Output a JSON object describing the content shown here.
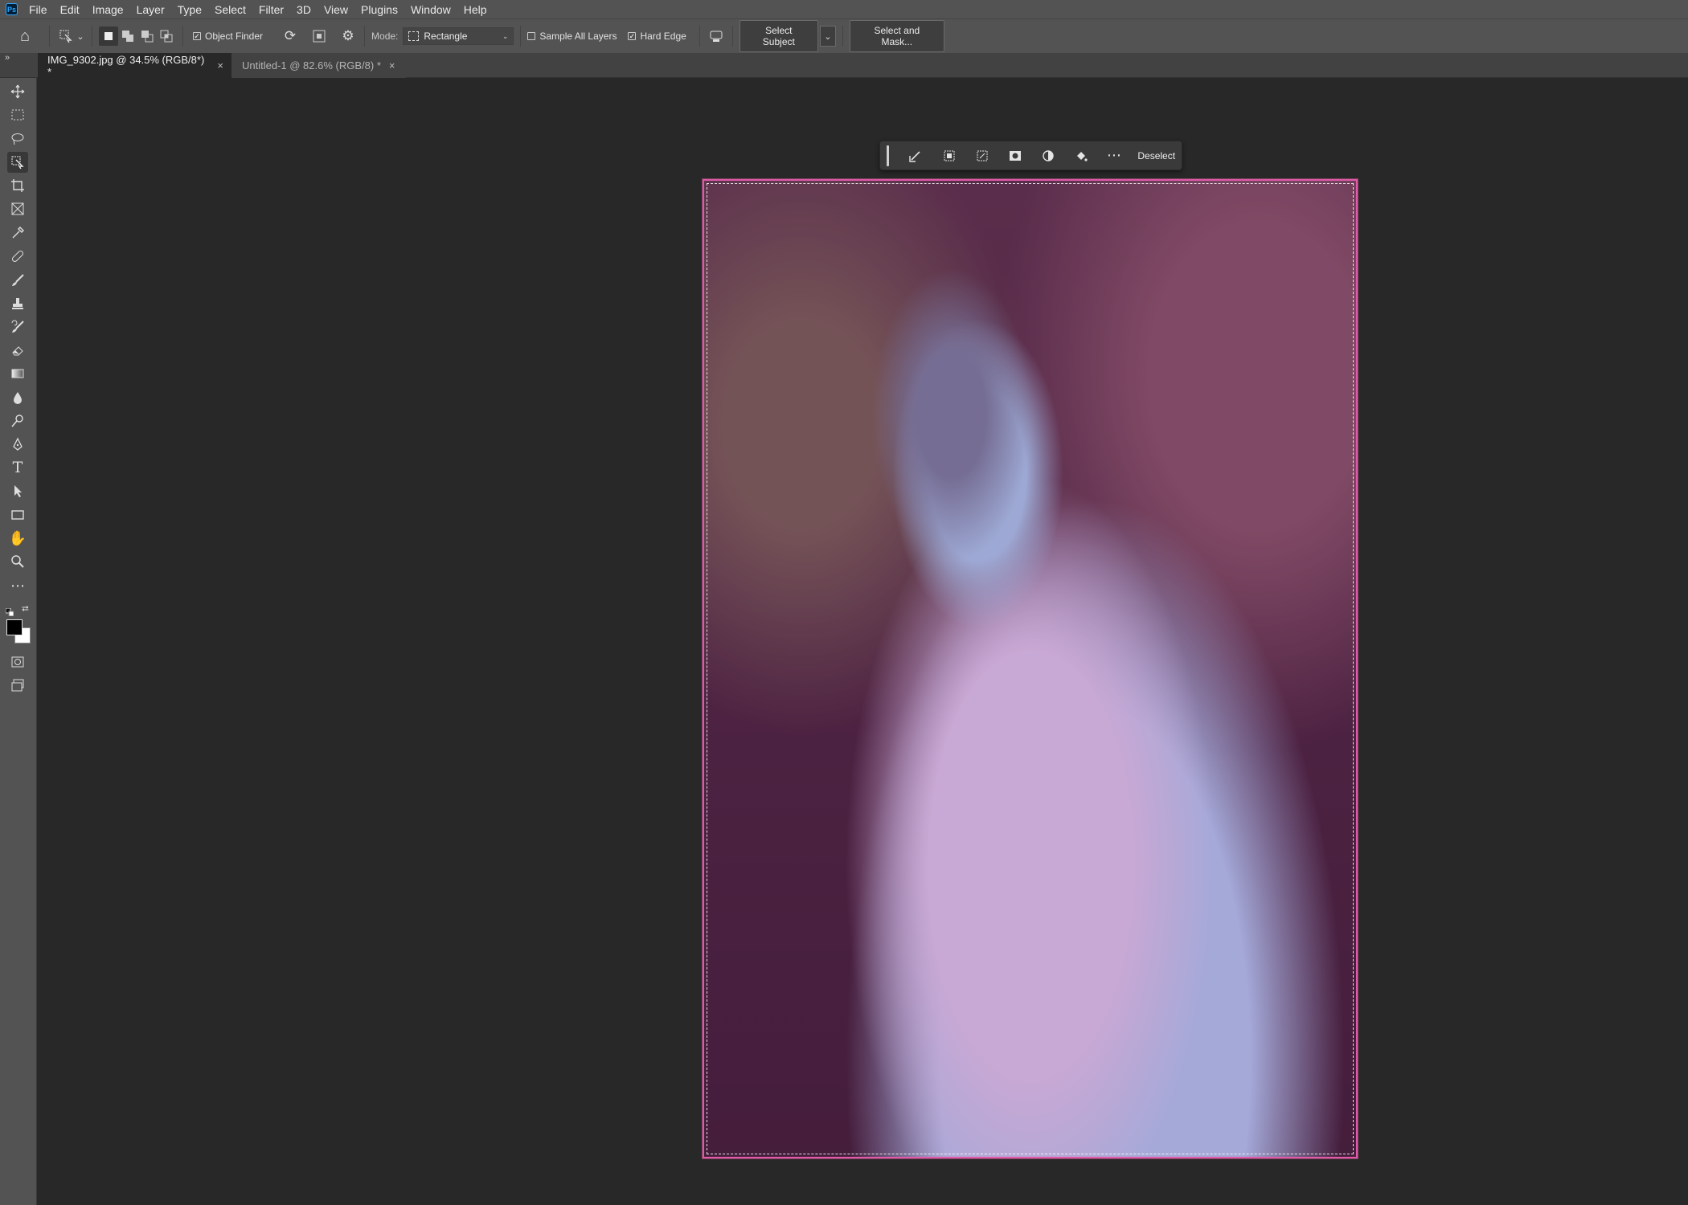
{
  "app": {
    "logo": "Ps"
  },
  "menu": [
    "File",
    "Edit",
    "Image",
    "Layer",
    "Type",
    "Select",
    "Filter",
    "3D",
    "View",
    "Plugins",
    "Window",
    "Help"
  ],
  "options": {
    "object_finder_label": "Object Finder",
    "object_finder_checked": true,
    "mode_label": "Mode:",
    "mode_value": "Rectangle",
    "sample_all_layers_label": "Sample All Layers",
    "sample_all_layers_checked": false,
    "hard_edge_label": "Hard Edge",
    "hard_edge_checked": true,
    "select_subject_label": "Select Subject",
    "select_and_mask_label": "Select and Mask..."
  },
  "tabs": [
    {
      "title": "IMG_9302.jpg @ 34.5% (RGB/8*) *",
      "active": true
    },
    {
      "title": "Untitled-1 @ 82.6% (RGB/8) *",
      "active": false
    }
  ],
  "taskbar": {
    "deselect_label": "Deselect"
  },
  "icons": {
    "home": "⌂",
    "check": "✓",
    "refresh": "⟳",
    "gear": "⚙",
    "close": "×",
    "chevron": "⌄",
    "more": "⋯"
  },
  "colors": {
    "selection": "#e05aa9",
    "accent": "#31a8ff"
  }
}
